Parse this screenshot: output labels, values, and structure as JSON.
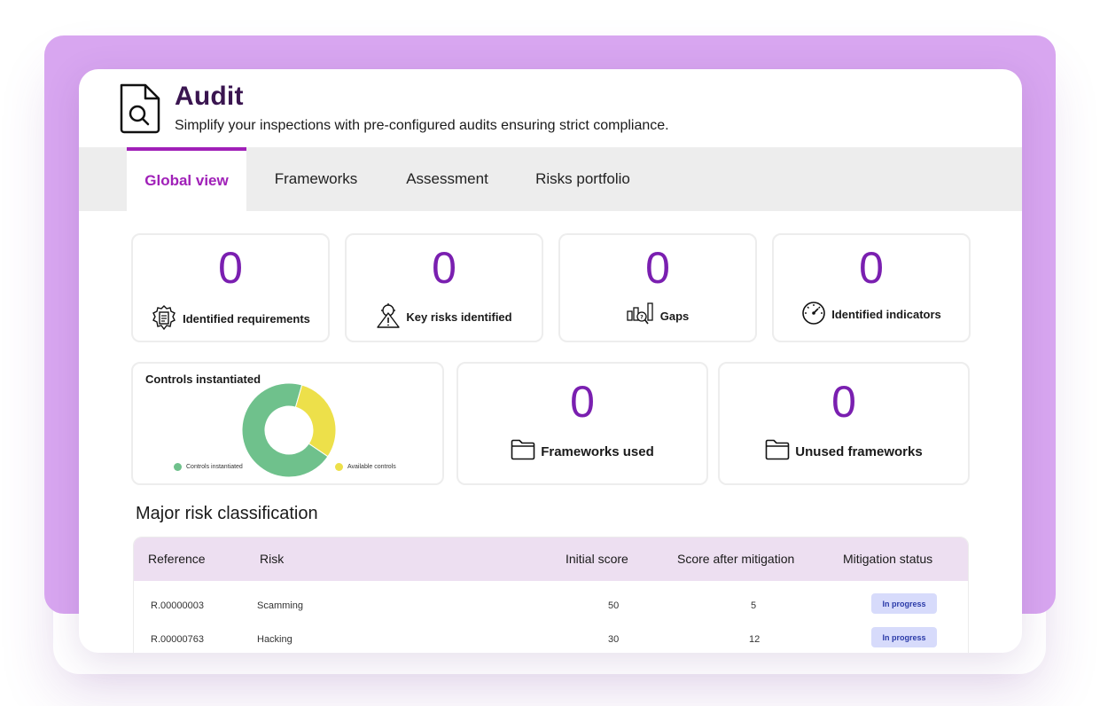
{
  "header": {
    "title": "Audit",
    "subtitle": "Simplify your inspections with pre-configured audits ensuring strict compliance.",
    "icon": "document-search-icon"
  },
  "tabs": [
    {
      "label": "Global view",
      "active": true
    },
    {
      "label": "Frameworks",
      "active": false
    },
    {
      "label": "Assessment",
      "active": false
    },
    {
      "label": "Risks portfolio",
      "active": false
    }
  ],
  "kpis": [
    {
      "value": "0",
      "label": "Identified requirements",
      "icon": "requirements-gear-icon"
    },
    {
      "value": "0",
      "label": "Key risks identified",
      "icon": "warning-gear-icon"
    },
    {
      "value": "0",
      "label": "Gaps",
      "icon": "bar-search-icon"
    },
    {
      "value": "0",
      "label": "Identified indicators",
      "icon": "gauge-icon"
    }
  ],
  "controls": {
    "title": "Controls instantiated",
    "legend": [
      {
        "label": "Controls instantiated",
        "color": "#6fc18c"
      },
      {
        "label": "Available controls",
        "color": "#ede04a"
      }
    ]
  },
  "chart_data": {
    "type": "pie",
    "title": "Controls instantiated",
    "categories": [
      "Controls instantiated",
      "Available controls"
    ],
    "values": [
      70,
      30
    ],
    "colors": [
      "#6fc18c",
      "#ede04a"
    ],
    "donut": true
  },
  "frameworks": [
    {
      "value": "0",
      "label": "Frameworks used",
      "icon": "folder-icon"
    },
    {
      "value": "0",
      "label": "Unused frameworks",
      "icon": "folder-icon"
    }
  ],
  "risks": {
    "title": "Major risk classification",
    "columns": [
      "Reference",
      "Risk",
      "Initial score",
      "Score after mitigation",
      "Mitigation status"
    ],
    "rows": [
      {
        "reference": "R.00000003",
        "risk": "Scamming",
        "initial": "50",
        "after": "5",
        "status": "In progress"
      },
      {
        "reference": "R.00000763",
        "risk": "Hacking",
        "initial": "30",
        "after": "12",
        "status": "In progress"
      }
    ]
  },
  "colors": {
    "accent": "#a020b8",
    "number": "#7a1fb0",
    "backdrop": "#d8a6f0",
    "table_header": "#eddff1",
    "badge": "#d7dbfb"
  }
}
